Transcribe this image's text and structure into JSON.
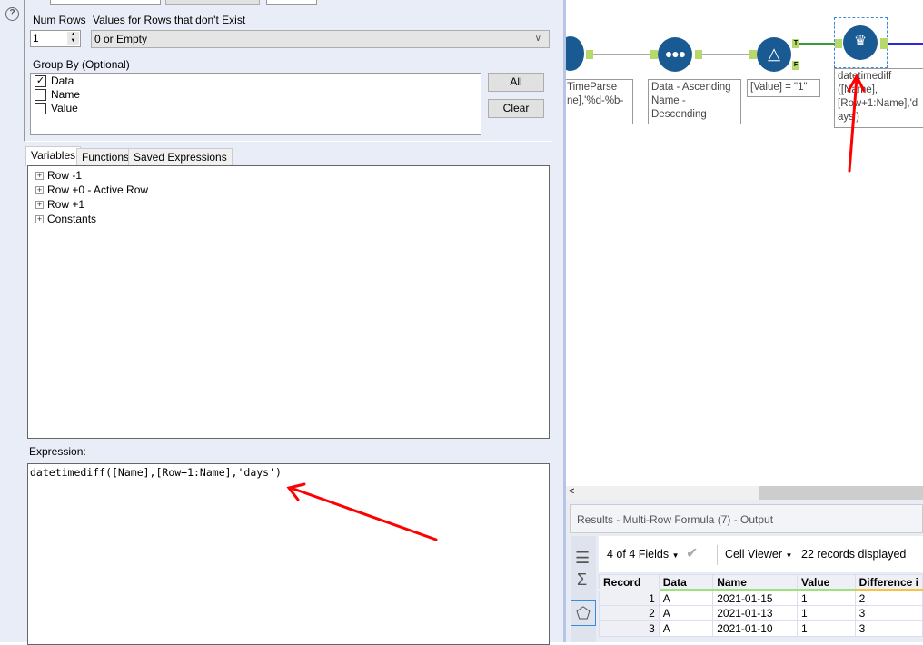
{
  "config": {
    "num_rows_label": "Num Rows",
    "num_rows_value": "1",
    "missing_label": "Values for Rows that don't Exist",
    "missing_value": "0 or Empty",
    "group_by_label": "Group By (Optional)",
    "group_by_fields": [
      {
        "name": "Data",
        "checked": true
      },
      {
        "name": "Name",
        "checked": false
      },
      {
        "name": "Value",
        "checked": false
      }
    ],
    "all_label": "All",
    "clear_label": "Clear"
  },
  "tabs": [
    "Variables",
    "Functions",
    "Saved Expressions"
  ],
  "tree": [
    "Row -1",
    "Row +0 - Active Row",
    "Row +1",
    "Constants"
  ],
  "expression": {
    "label": "Expression:",
    "value": "datetimediff([Name],[Row+1:Name],'days')"
  },
  "canvas": {
    "nodes": [
      {
        "label": "TimeParse\nne],'%d-%b-"
      },
      {
        "label": "Data - Ascending\nName -\nDescending"
      },
      {
        "label": "[Value] = \"1\"",
        "true_anchor": "T",
        "false_anchor": "F"
      },
      {
        "label": "datetimediff\n([Name],\n[Row+1:Name],'d\nays')"
      }
    ]
  },
  "results": {
    "title": "Results - Multi-Row Formula (7) - Output",
    "fields": "4 of 4 Fields",
    "viewer": "Cell Viewer",
    "records": "22 records displayed",
    "columns": [
      "Record",
      "Data",
      "Name",
      "Value",
      "Difference i"
    ],
    "rows": [
      [
        "1",
        "A",
        "2021-01-15",
        "1",
        "2"
      ],
      [
        "2",
        "A",
        "2021-01-13",
        "1",
        "3"
      ],
      [
        "3",
        "A",
        "2021-01-10",
        "1",
        "3"
      ]
    ]
  },
  "colors": {
    "accent": "#1a5a92",
    "annotation": "#ff0000"
  }
}
